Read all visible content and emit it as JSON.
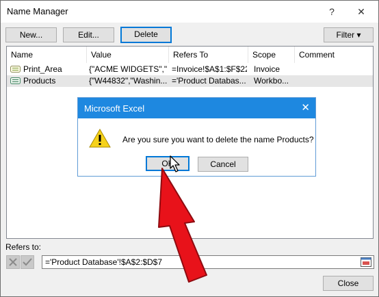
{
  "window": {
    "title": "Name Manager",
    "help_glyph": "?",
    "close_glyph": "✕"
  },
  "toolbar": {
    "new_label": "New...",
    "edit_label": "Edit...",
    "delete_label": "Delete",
    "filter_label": "Filter ▾"
  },
  "table": {
    "headers": [
      "Name",
      "Value",
      "Refers To",
      "Scope",
      "Comment"
    ],
    "rows": [
      {
        "name": "Print_Area",
        "value": "{\"ACME WIDGETS\",\"...",
        "refers_to": "=Invoice!$A$1:$F$22",
        "scope": "Invoice",
        "comment": ""
      },
      {
        "name": "Products",
        "value": "{\"W44832\",\"Washin...",
        "refers_to": "='Product Databas...",
        "scope": "Workbo...",
        "comment": ""
      }
    ]
  },
  "refers": {
    "label": "Refers to:",
    "value": "='Product Database'!$A$2:$D$7"
  },
  "footer": {
    "close_label": "Close"
  },
  "dialog": {
    "title": "Microsoft Excel",
    "close_glyph": "✕",
    "message": "Are you sure you want to delete the name Products?",
    "ok_label": "OK",
    "cancel_label": "Cancel"
  },
  "colors": {
    "dialog_title_bar": "#1e88e0",
    "annotation_arrow": "#e8121a",
    "focus_border": "#0078d7"
  }
}
